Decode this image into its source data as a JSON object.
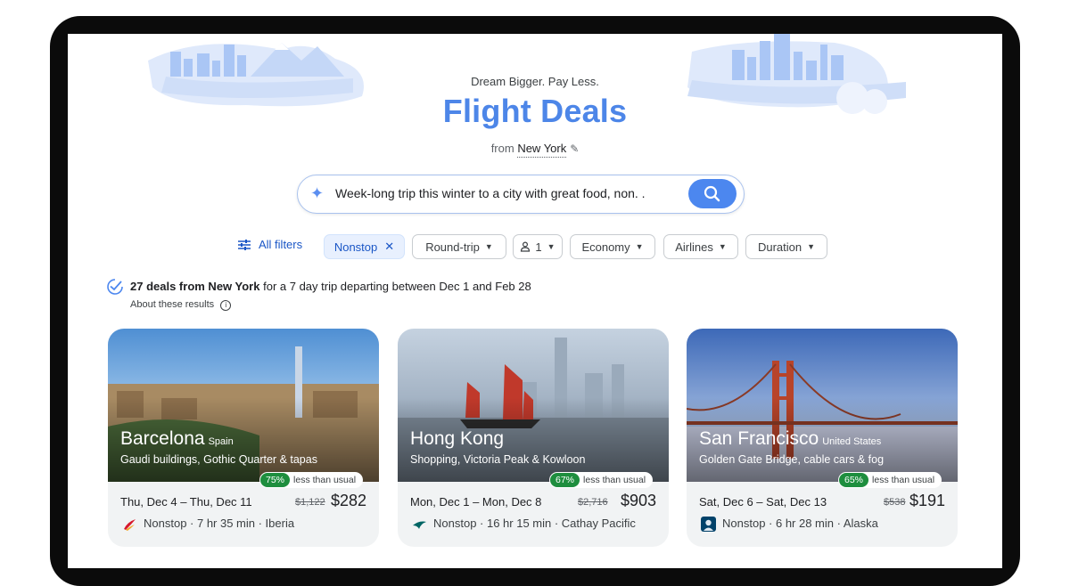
{
  "header": {
    "tagline": "Dream Bigger. Pay Less.",
    "title": "Flight Deals",
    "from_prefix": "from",
    "from_city": "New York"
  },
  "search": {
    "query": "Week-long trip this winter to a city with great food, non. .",
    "icon": "sparkle-icon",
    "button_icon": "search-icon"
  },
  "filters": {
    "all_filters": "All filters",
    "nonstop": "Nonstop",
    "trip_type": "Round-trip",
    "passengers": "1",
    "cabin": "Economy",
    "airlines": "Airlines",
    "duration": "Duration"
  },
  "results": {
    "count_text": "27 deals from New York",
    "detail_text": " for a 7 day trip departing between Dec 1 and Feb 28",
    "about": "About these results"
  },
  "cards": [
    {
      "city": "Barcelona",
      "country": "Spain",
      "highlights": "Gaudi buildings, Gothic Quarter & tapas",
      "discount": "75%",
      "discount_label": "less than usual",
      "dates": "Thu, Dec 4 – Thu, Dec 11",
      "old_price": "$1,122",
      "price": "$282",
      "route": "Nonstop · 7 hr 35 min · Iberia"
    },
    {
      "city": "Hong Kong",
      "country": "",
      "highlights": "Shopping, Victoria Peak & Kowloon",
      "discount": "67%",
      "discount_label": "less than usual",
      "dates": "Mon, Dec 1 – Mon, Dec 8",
      "old_price": "$2,716",
      "price": "$903",
      "route": "Nonstop · 16 hr 15 min · Cathay Pacific"
    },
    {
      "city": "San Francisco",
      "country": "United States",
      "highlights": "Golden Gate Bridge, cable cars & fog",
      "discount": "65%",
      "discount_label": "less than usual",
      "dates": "Sat, Dec 6 – Sat, Dec 13",
      "old_price": "$538",
      "price": "$191",
      "route": "Nonstop · 6 hr 28 min · Alaska"
    }
  ],
  "colors": {
    "accent": "#4d86e8",
    "deal_green": "#1e8e3e",
    "chip_active": "#e8f0fe"
  }
}
